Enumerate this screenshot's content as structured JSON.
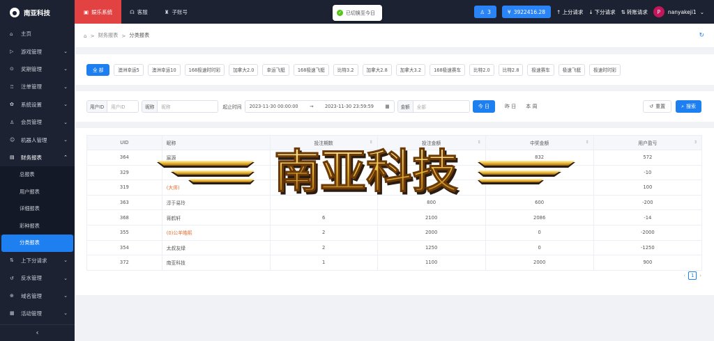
{
  "sidebar": {
    "logo": "南亚科技",
    "items": [
      {
        "label": "主页",
        "icon": "⌂",
        "chev": ""
      },
      {
        "label": "游戏管理",
        "icon": "▷",
        "chev": "⌄"
      },
      {
        "label": "奖期管理",
        "icon": "⊙",
        "chev": "⌄"
      },
      {
        "label": "注单管理",
        "icon": "♖",
        "chev": "⌄"
      },
      {
        "label": "系统设置",
        "icon": "✿",
        "chev": "⌄"
      },
      {
        "label": "会员管理",
        "icon": "♙",
        "chev": "⌄"
      },
      {
        "label": "机器人管理",
        "icon": "☺",
        "chev": "⌄"
      },
      {
        "label": "财务报表",
        "icon": "▤",
        "chev": "⌃"
      }
    ],
    "subitems": [
      "总报表",
      "用户报表",
      "详细报表",
      "彩种报表",
      "分类报表"
    ],
    "items2": [
      {
        "label": "上下分请求",
        "icon": "⇅",
        "chev": "⌄"
      },
      {
        "label": "反水管理",
        "icon": "↺",
        "chev": "⌄"
      },
      {
        "label": "域名管理",
        "icon": "⊕",
        "chev": "⌄"
      },
      {
        "label": "活动管理",
        "icon": "▦",
        "chev": "⌄"
      }
    ],
    "collapse": "‹"
  },
  "topbar": {
    "tabs": [
      "娱乐系统",
      "客服",
      "子账号"
    ],
    "toast": "已切换至今日",
    "badge_count": "3",
    "balance": "3922416.28",
    "links": [
      "上分请求",
      "下分请求",
      "转账请求"
    ],
    "avatar": "P",
    "username": "nanyakeji1"
  },
  "breadcrumb": {
    "level1": "财务报表",
    "level2": "分类报表"
  },
  "categories": [
    "全 部",
    "澳洲幸运5",
    "澳洲幸运10",
    "168极速时时彩",
    "加拿大2.0",
    "幸运飞艇",
    "168极速飞艇",
    "比特3.2",
    "加拿大2.8",
    "加拿大3.2",
    "168极速赛车",
    "比特2.0",
    "比特2.8",
    "极速赛车",
    "极速飞艇",
    "极速时时彩"
  ],
  "filter": {
    "uid_label": "用户ID",
    "uid_placeholder": "用户ID",
    "nick_label": "昵称",
    "nick_placeholder": "昵称",
    "time_label": "起止时间",
    "start": "2023-11-30 00:00:00",
    "end": "2023-11-30 23:59:59",
    "amount_label": "金额",
    "amount_placeholder": "全部",
    "today": "今 日",
    "yesterday": "昨 日",
    "week": "本 周",
    "reset": "重置",
    "search": "搜索"
  },
  "table": {
    "headers": [
      "UID",
      "昵称",
      "投注期数",
      "投注金额",
      "中奖金额",
      "用户盈亏"
    ],
    "rows": [
      [
        "364",
        "宸源",
        "",
        "",
        "832",
        "572"
      ],
      [
        "329",
        "",
        "",
        "10",
        "",
        "-10"
      ],
      [
        "319",
        "(大师)",
        "",
        "",
        "",
        "100"
      ],
      [
        "363",
        "淳于易玲",
        "",
        "800",
        "600",
        "-200"
      ],
      [
        "368",
        "蒋鹤轩",
        "6",
        "2100",
        "2086",
        "-14"
      ],
      [
        "355",
        "(0)公羊皓熙",
        "2",
        "2000",
        "0",
        "-2000"
      ],
      [
        "354",
        "太叔友绿",
        "2",
        "1250",
        "0",
        "-1250"
      ],
      [
        "372",
        "南亚科技",
        "1",
        "1100",
        "2000",
        "900"
      ]
    ],
    "page": "1"
  },
  "watermark": "南亚科技"
}
